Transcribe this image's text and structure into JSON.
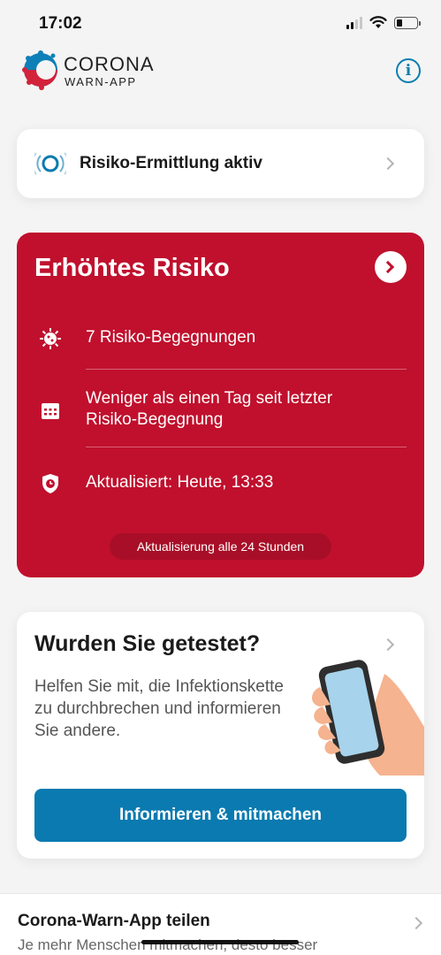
{
  "status_bar": {
    "time": "17:02",
    "signal_icon": "signal-icon",
    "wifi_icon": "wifi-icon",
    "battery_icon": "battery-icon",
    "battery_level": 0.3
  },
  "header": {
    "brand_title": "CORONA",
    "brand_subtitle": "WARN-APP",
    "info_icon": "info-icon"
  },
  "tracing_card": {
    "label": "Risiko-Ermittlung aktiv",
    "icon": "tracing-active-icon"
  },
  "risk_card": {
    "title": "Erhöhtes Risiko",
    "background_color": "#c0102d",
    "rows": [
      {
        "icon": "virus-icon",
        "text": "7 Risiko-Begegnungen"
      },
      {
        "icon": "calendar-icon",
        "text": "Weniger als einen Tag seit letzter Risiko-Begegnung"
      },
      {
        "icon": "shield-clock-icon",
        "text": "Aktualisiert: Heute, 13:33"
      }
    ],
    "update_interval": "Aktualisierung alle 24 Stunden"
  },
  "test_card": {
    "title": "Wurden Sie getestet?",
    "body": "Helfen Sie mit, die Infektionskette zu durchbrechen und informieren Sie andere.",
    "button_label": "Informieren & mitmachen",
    "button_color": "#0a7ab0",
    "illustration": "hand-holding-phone-illustration"
  },
  "share_section": {
    "title": "Corona-Warn-App teilen",
    "subtitle": "Je mehr Menschen mitmachen, desto besser"
  }
}
